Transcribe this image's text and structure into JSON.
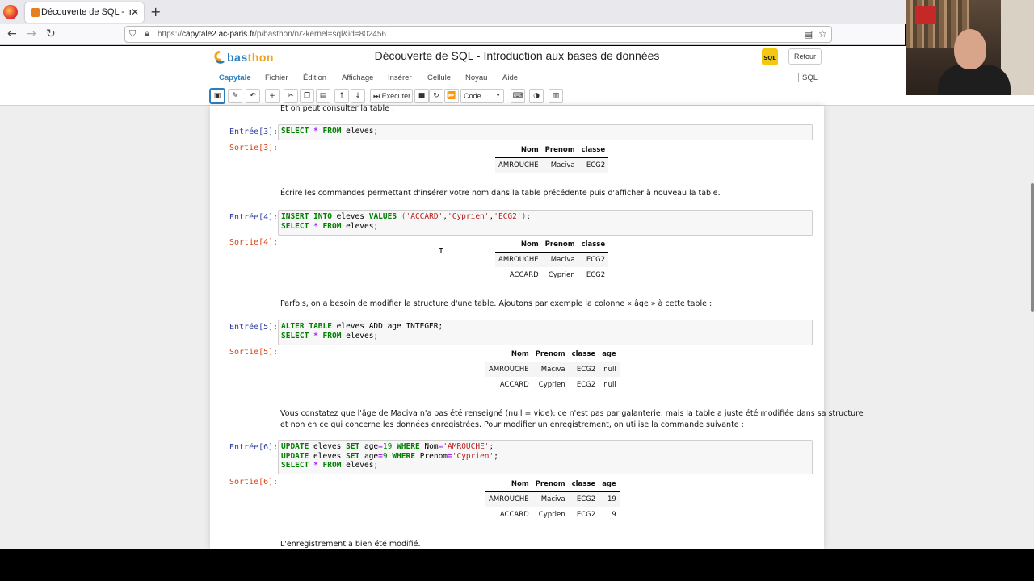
{
  "browser": {
    "tab_title": "Découverte de SQL - Introduc",
    "tab_close": "✕",
    "new_tab": "+",
    "url_prefix": "https://",
    "url_host": "capytale2.ac-paris.fr",
    "url_path": "/p/basthon/n/?kernel=sql&id=802456"
  },
  "header": {
    "logo_bas": "bas",
    "logo_thon": "thon",
    "title": "Découverte de SQL - Introduction aux bases de données",
    "sql_badge": "SQL",
    "back_button": "Retour"
  },
  "menu": {
    "brand": "Capytale",
    "items": [
      "Fichier",
      "Édition",
      "Affichage",
      "Insérer",
      "Cellule",
      "Noyau",
      "Aide"
    ],
    "kernel": "SQL"
  },
  "toolbar": {
    "run_label": "Exécuter",
    "cell_type": "Code"
  },
  "cells": {
    "md0": "Et on peut consulter la table :",
    "in3_prompt": "Entrée[3]:",
    "out3_prompt": "Sortie[3]:",
    "md1": "Écrire les commandes permettant d'insérer votre nom dans la table précédente puis d'afficher à nouveau la table.",
    "in4_prompt": "Entrée[4]:",
    "out4_prompt": "Sortie[4]:",
    "md2": "Parfois, on a besoin de modifier la structure d'une table. Ajoutons par exemple la colonne « âge » à cette table :",
    "in5_prompt": "Entrée[5]:",
    "out5_prompt": "Sortie[5]:",
    "md3_line1": "Vous constatez que l'âge de Maciva n'a pas été renseigné (null = vide): ce n'est pas par galanterie, mais la table a juste été modifiée dans sa structure",
    "md3_line2": "et non en ce qui concerne les données enregistrées. Pour modifier un enregistrement, on utilise la commande suivante :",
    "in6_prompt": "Entrée[6]:",
    "out6_prompt": "Sortie[6]:",
    "md4": "L'enregistrement a bien été modifié."
  },
  "tables": {
    "t3": {
      "headers": [
        "Nom",
        "Prenom",
        "classe"
      ],
      "rows": [
        [
          "AMROUCHE",
          "Maciva",
          "ECG2"
        ]
      ]
    },
    "t4": {
      "headers": [
        "Nom",
        "Prenom",
        "classe"
      ],
      "rows": [
        [
          "AMROUCHE",
          "Maciva",
          "ECG2"
        ],
        [
          "ACCARD",
          "Cyprien",
          "ECG2"
        ]
      ]
    },
    "t5": {
      "headers": [
        "Nom",
        "Prenom",
        "classe",
        "age"
      ],
      "rows": [
        [
          "AMROUCHE",
          "Maciva",
          "ECG2",
          "null"
        ],
        [
          "ACCARD",
          "Cyprien",
          "ECG2",
          "null"
        ]
      ]
    },
    "t6": {
      "headers": [
        "Nom",
        "Prenom",
        "classe",
        "age"
      ],
      "rows": [
        [
          "AMROUCHE",
          "Maciva",
          "ECG2",
          "19"
        ],
        [
          "ACCARD",
          "Cyprien",
          "ECG2",
          "9"
        ]
      ]
    }
  },
  "colors": {
    "brand_blue": "#2a7fbf",
    "brand_orange": "#f3a21b",
    "prompt_in": "#303f9f",
    "prompt_out": "#d84315",
    "keyword": "#008000",
    "string": "#ba2121"
  }
}
